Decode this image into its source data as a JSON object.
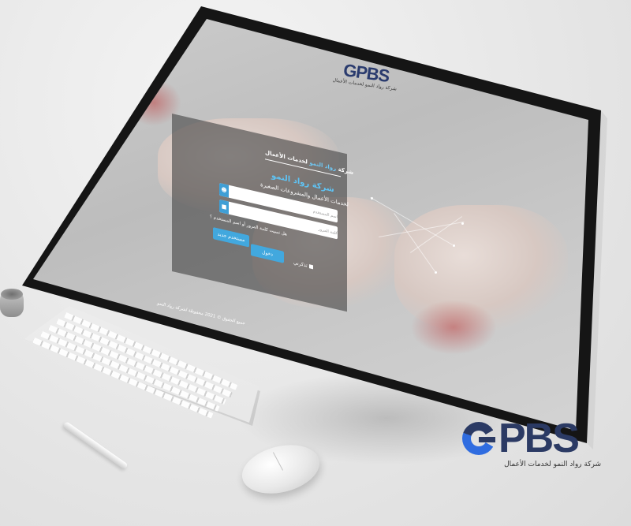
{
  "screen": {
    "logo_text": "GPBS",
    "logo_subtitle": "شركة رواد النمو لخدمات الأعمال",
    "login": {
      "header_prefix": "شركة",
      "header_highlight": "رواد النمو",
      "header_suffix": "لخدمات الأعمال",
      "title": "شركة رواد النمو",
      "subtitle": "لخدمات الأعمال والمشروعات الصغيرة",
      "username_placeholder": "اسم المستخدم",
      "password_placeholder": "كلمة المرور",
      "forgot_prompt": "هل نسيت كلمة المرور أو اسم المستخدم ؟",
      "login_button": "دخول",
      "register_button": "مستخدم جديد",
      "remember_label": "تذكرني"
    },
    "copyright": "جميع الحقوق © 2021 محفوظة لشركة رواد النمو"
  },
  "brand": {
    "word": "PBS",
    "tagline": "شركة رواد النمو لخدمات الأعمال",
    "colors": {
      "navy": "#2b3a64",
      "blue": "#2f6ce0",
      "accent": "#42a8de"
    }
  }
}
